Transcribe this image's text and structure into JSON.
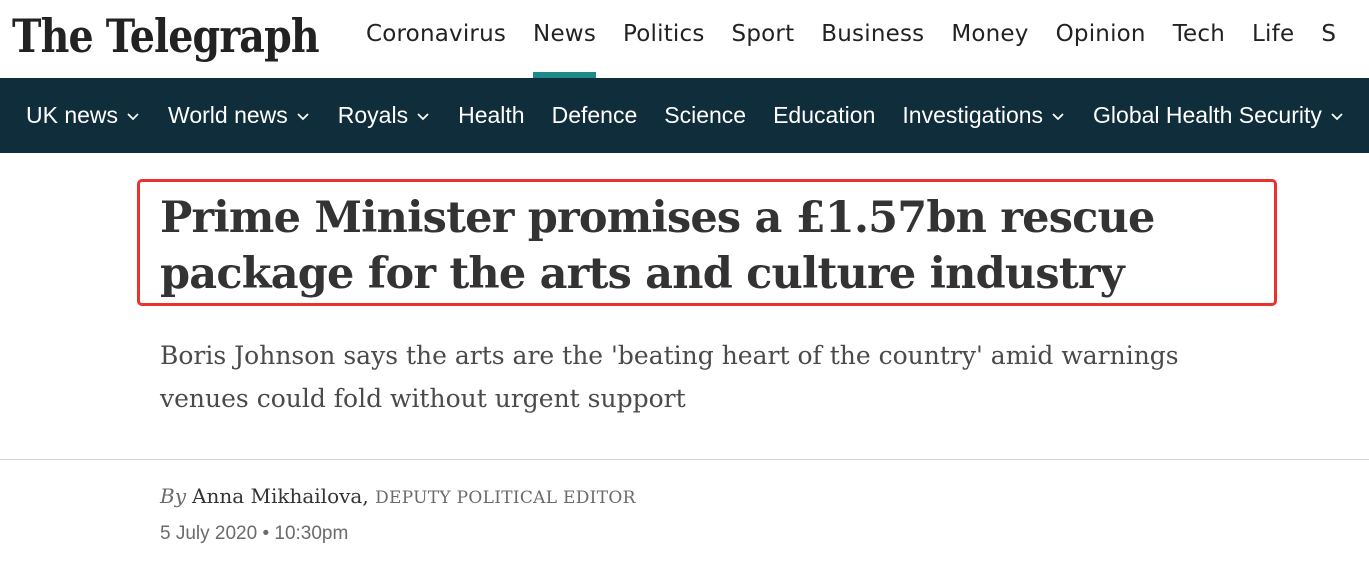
{
  "header": {
    "logo_text": "The Telegraph",
    "nav": [
      {
        "label": "Coronavirus",
        "active": false
      },
      {
        "label": "News",
        "active": true
      },
      {
        "label": "Politics",
        "active": false
      },
      {
        "label": "Sport",
        "active": false
      },
      {
        "label": "Business",
        "active": false
      },
      {
        "label": "Money",
        "active": false
      },
      {
        "label": "Opinion",
        "active": false
      },
      {
        "label": "Tech",
        "active": false
      },
      {
        "label": "Life",
        "active": false
      },
      {
        "label": "S",
        "active": false
      }
    ]
  },
  "subnav": {
    "items": [
      {
        "label": "UK news",
        "dropdown": true
      },
      {
        "label": "World news",
        "dropdown": true
      },
      {
        "label": "Royals",
        "dropdown": true
      },
      {
        "label": "Health",
        "dropdown": false
      },
      {
        "label": "Defence",
        "dropdown": false
      },
      {
        "label": "Science",
        "dropdown": false
      },
      {
        "label": "Education",
        "dropdown": false
      },
      {
        "label": "Investigations",
        "dropdown": true
      },
      {
        "label": "Global Health Security",
        "dropdown": true
      }
    ]
  },
  "article": {
    "headline": "Prime Minister promises a £1.57bn rescue package for the arts and culture industry",
    "standfirst": "Boris Johnson says the arts are the 'beating heart of the country' amid warnings venues could fold without urgent support",
    "byline_prefix": "By",
    "author": "Anna Mikhailova,",
    "author_role": "DEPUTY POLITICAL EDITOR",
    "date": "5 July 2020 • 10:30pm"
  },
  "colors": {
    "subnav_background": "#0f2d3a",
    "active_tab_underline": "#1f8a8a",
    "highlight_box": "#e8332e"
  },
  "icons": {
    "dropdown": "chevron-down-icon"
  }
}
